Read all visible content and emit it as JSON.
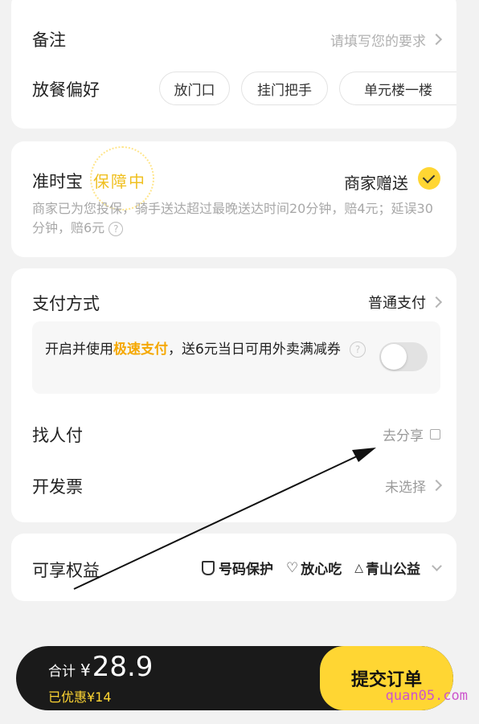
{
  "remarks": {
    "label": "备注",
    "placeholder": "请填写您的要求"
  },
  "preference": {
    "label": "放餐偏好",
    "options": [
      "放门口",
      "挂门把手",
      "单元楼一楼"
    ]
  },
  "ontime": {
    "title": "准时宝",
    "stamp": "保障中",
    "gift": "商家赠送",
    "desc": "商家已为您投保，骑手送达超过最晚送达时间20分钟，赔4元；延误30分钟，赔6元"
  },
  "payment": {
    "label": "支付方式",
    "value": "普通支付",
    "promo_prefix": "开启并使用",
    "promo_highlight": "极速支付",
    "promo_suffix": "，送6元当日可用外卖满减券",
    "toggle_on": false
  },
  "find_pay": {
    "label": "找人付",
    "value": "去分享"
  },
  "invoice": {
    "label": "开发票",
    "value": "未选择"
  },
  "benefits": {
    "label": "可享权益",
    "items": [
      "号码保护",
      "放心吃",
      "青山公益"
    ]
  },
  "footer": {
    "total_label": "合计",
    "currency": "¥",
    "total": "28.9",
    "discount": "已优惠¥14",
    "submit": "提交订单",
    "watermark": "quan05.com"
  },
  "colors": {
    "accent": "#ffd633",
    "highlight": "#f5a800",
    "dark_bar": "#1a1a1a"
  }
}
